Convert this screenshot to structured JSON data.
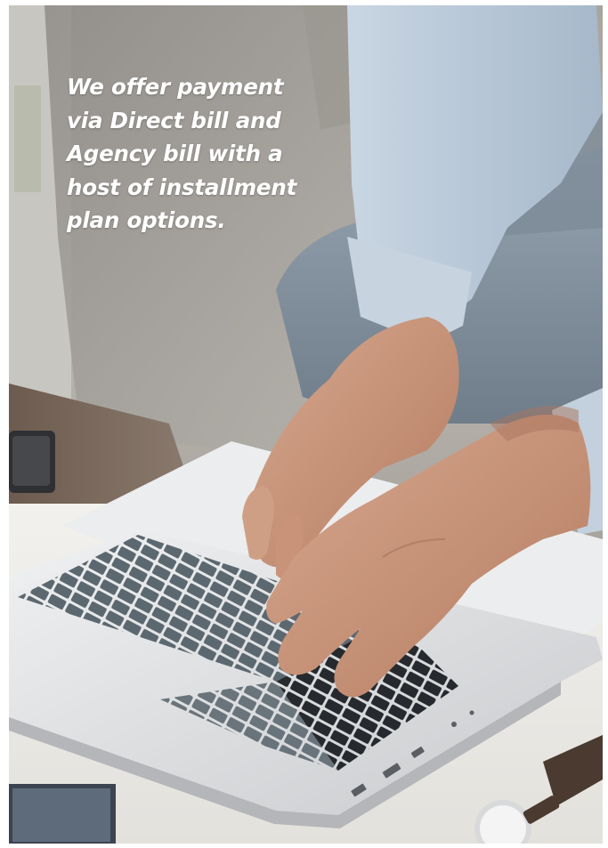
{
  "headline": {
    "lines": [
      "We offer payment",
      "via Direct bill and",
      "Agency bill with a",
      "host of installment",
      "plan options."
    ]
  },
  "photo": {
    "subject": "hands-typing-on-laptop",
    "colors": {
      "sofa": "#a8a49d",
      "shirt": "#b9c8d8",
      "jeans": "#8696a5",
      "table": "#ebe9e4",
      "laptop": "#d9dadc",
      "keys": "#56636b",
      "skin": "#c9957a",
      "watch_strap": "#4a3a30"
    }
  }
}
